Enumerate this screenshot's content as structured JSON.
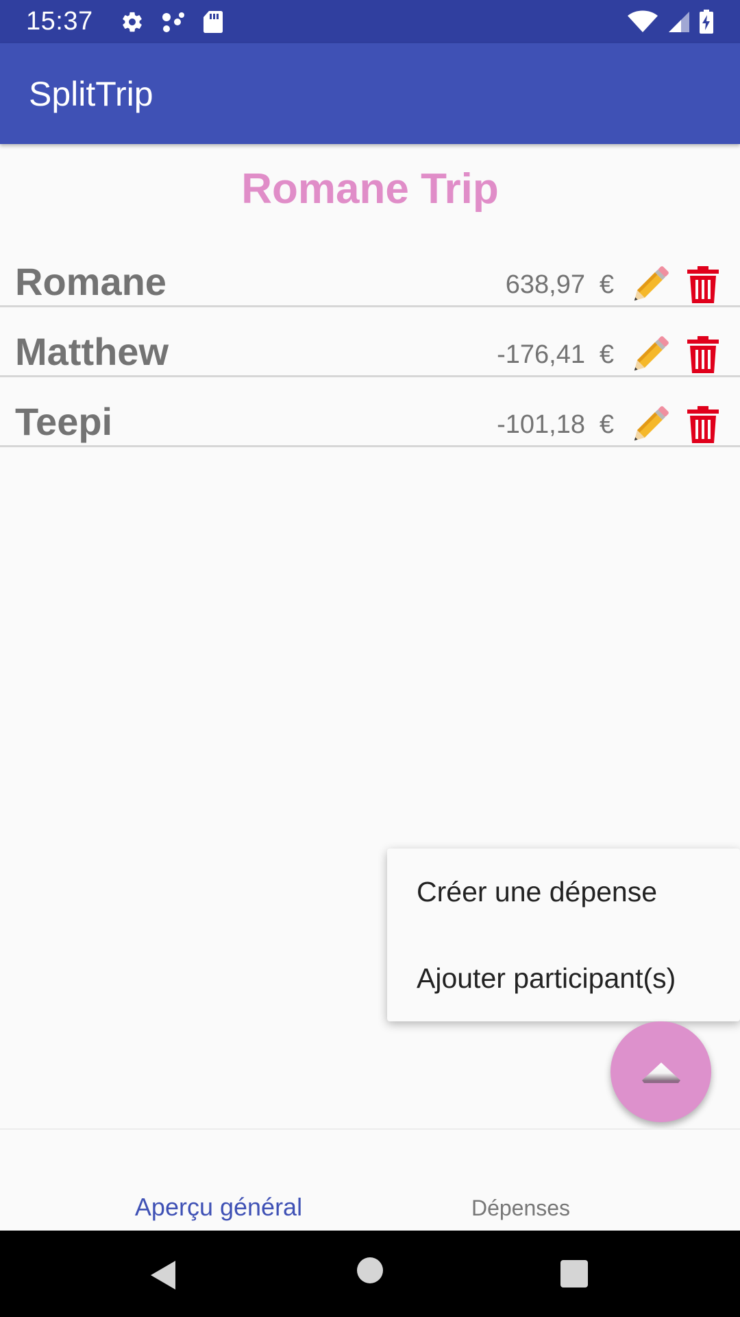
{
  "status_bar": {
    "time": "15:37",
    "left_icons": [
      "gear-icon",
      "dots-icon",
      "sd-card-icon"
    ],
    "right_icons": [
      "wifi-icon",
      "signal-icon",
      "battery-icon"
    ]
  },
  "app_bar": {
    "title": "SplitTrip",
    "color": "#3f51b5"
  },
  "trip": {
    "title": "Romane Trip",
    "color": "#e08dc8"
  },
  "participants": [
    {
      "name": "Romane",
      "balance": "638,97",
      "currency": "€"
    },
    {
      "name": "Matthew",
      "balance": "-176,41",
      "currency": "€"
    },
    {
      "name": "Teepi",
      "balance": "-101,18",
      "currency": "€"
    }
  ],
  "popup_menu": {
    "items": [
      {
        "label": "Créer une dépense"
      },
      {
        "label": "Ajouter participant(s)"
      }
    ]
  },
  "fab": {
    "icon": "chevron-up-icon",
    "color": "#dd91cc"
  },
  "bottom_tabs": {
    "overview_label": "Aperçu général",
    "expenses_label": "Dépenses",
    "active": "overview"
  },
  "nav_bar": {
    "icons": [
      "back-icon",
      "home-icon",
      "recents-icon"
    ]
  }
}
